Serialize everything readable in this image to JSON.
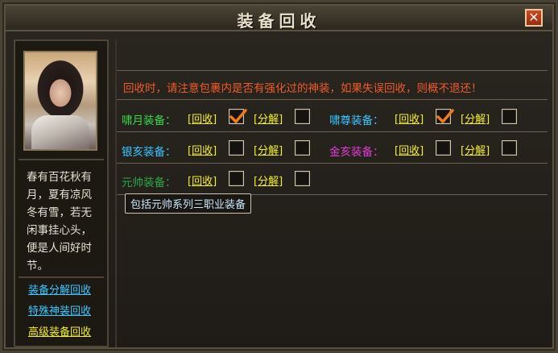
{
  "window": {
    "title": "装备回收",
    "close_label": "✕"
  },
  "sidebar": {
    "poem": "春有百花秋有月，夏有凉风冬有雪，若无闲事挂心头，便是人间好时节。",
    "links": [
      {
        "label": "装备分解回收",
        "color": "#39c6ff"
      },
      {
        "label": "特殊神装回收",
        "color": "#39c6ff"
      },
      {
        "label": "高级装备回收",
        "color": "#f2ee2a"
      }
    ]
  },
  "main": {
    "notice": "回收时，请注意包裹内是否有强化过的神装，如果失误回收，则概不退还！",
    "recycle_label": "[回收]",
    "decompose_label": "[分解]",
    "rows": [
      {
        "label": "啸月装备：",
        "color": "#38d84a",
        "recycle_checked": true,
        "decompose_checked": false
      },
      {
        "label": "啸尊装备：",
        "color": "#39c6ff",
        "recycle_checked": true,
        "decompose_checked": false
      },
      {
        "label": "银亥装备：",
        "color": "#39c6ff",
        "recycle_checked": false,
        "decompose_checked": false
      },
      {
        "label": "金亥装备：",
        "color": "#e43ad8",
        "recycle_checked": false,
        "decompose_checked": false
      },
      {
        "label": "元帅装备：",
        "color": "#2fa84a",
        "recycle_checked": false,
        "decompose_checked": false
      }
    ],
    "tooltip": "包括元帅系列三职业装备"
  }
}
